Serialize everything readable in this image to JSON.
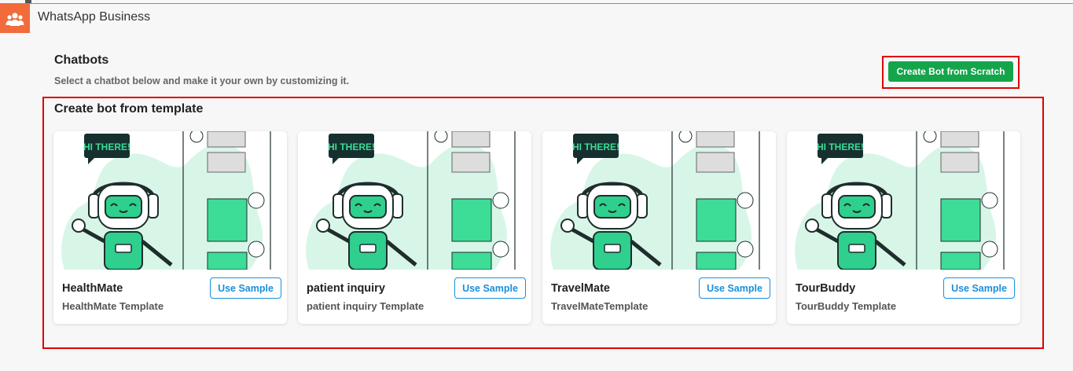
{
  "app": {
    "title": "WhatsApp Business",
    "icon": "users-group-icon",
    "accent": "#f26b3a"
  },
  "header": {
    "title": "Chatbots",
    "subtitle": "Select a chatbot below and make it your own by customizing it."
  },
  "actions": {
    "create_scratch_label": "Create Bot from Scratch",
    "create_color": "#14a54b"
  },
  "templates": {
    "section_title": "Create bot from template",
    "illustration_text": "HI THERE!",
    "use_label": "Use Sample",
    "items": [
      {
        "name": "HealthMate",
        "desc": "HealthMate Template"
      },
      {
        "name": "patient inquiry",
        "desc": "patient inquiry Template"
      },
      {
        "name": "TravelMate",
        "desc": "TravelMateTemplate"
      },
      {
        "name": "TourBuddy",
        "desc": "TourBuddy Template"
      }
    ]
  }
}
